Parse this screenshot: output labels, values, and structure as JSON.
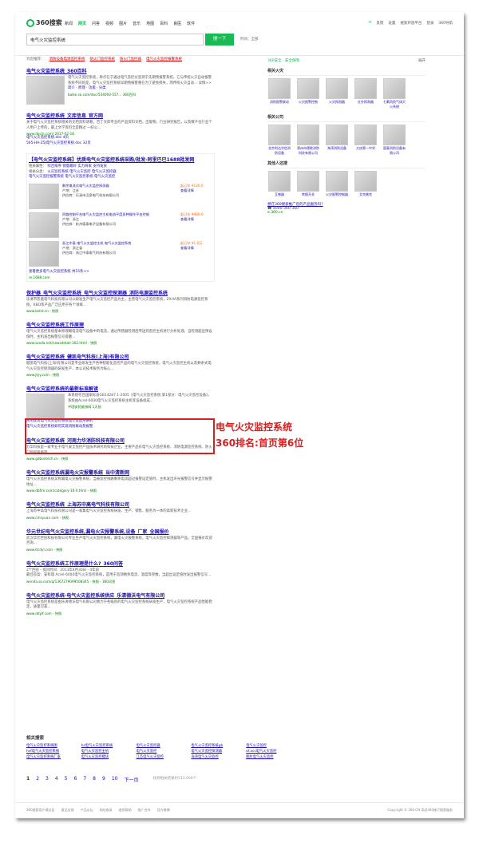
{
  "header": {
    "logo_text": "360搜索",
    "nav": [
      "新闻",
      "网页",
      "问答",
      "视频",
      "图片",
      "音乐",
      "地图",
      "百科",
      "良医",
      "软件"
    ],
    "nav_active_index": 1,
    "search_value": "电气火灾监控系统",
    "search_button": "搜一下",
    "time_filter": "时间：全部",
    "top_links": [
      "反馈",
      "设置",
      "搜索开放平台",
      "登录",
      "360导航"
    ],
    "accent_color": "#19b955"
  },
  "suggest": {
    "label": "为您推荐：",
    "items": [
      "消防设备电源监控系统",
      "防火门监控系统",
      "防火门监控器",
      "电气火灾监控报警系统"
    ]
  },
  "results": [
    {
      "title": "电气火灾监控系统_360百科",
      "desc": "电气火灾监控系统，将点在于通过电气监控仪监测于先期预报警系统，它与传统火灾自动报警系统不同的是，电气火灾监控系统早期预报警重在为了避免损失，而传统火灾自动... 详情>>",
      "sub": "简介 · 原理 · 功能 · 分类",
      "url": "baike.so.com/doc/534093-557...",
      "source_tag": "360百科"
    },
    {
      "title": "电气火灾监控系统_文库信息_官方网",
      "desc": "关于电气火灾监控系统相关的文档资料请看，百丁文库专业的产品资料文档，出版物，行业研究报告，以及数千位行业个人用户上传的，最上文学资料全是精过 一纪公...",
      "url": "www.docin.com/ 2017-02-18",
      "file1": "电气火灾监控系统.doc 4页",
      "file2": "565-HA-Z5J电气火灾监控系统.doc 32页"
    },
    {
      "title": "【电气火灾监控系统】优质电气火灾监控系统采购/批发-阿里巴巴1688批发网",
      "filters": [
        {
          "label": "相关属性：",
          "values": [
            "综合排序",
            "销量最好",
            "实力商家",
            "支持发货"
          ]
        },
        {
          "label": "相关分类：",
          "values": [
            "火灾监控系统",
            "电气火灾监控",
            "电气火灾监控器"
          ]
        },
        {
          "label": "",
          "values": [
            "电气火灾监控报警系统",
            "电气火灾监控系统",
            "电气火灾监控"
          ]
        }
      ],
      "products": [
        {
          "name": "剩余电流式电气火灾监控探测器",
          "price": "起订价 ¥120.0",
          "loc": "产地：江苏",
          "supplier": "供应商：乐清市汉泉电气科技有限公司",
          "action": "查看详情"
        },
        {
          "name": "四路控制平台电气火灾监控主机电流平度多种操作平台控制",
          "price": "起订价 ¥980.0",
          "loc": "产地：浙江",
          "supplier": "供应商：杭州德泰电子设备有限公司",
          "action": "查看详情"
        },
        {
          "name": "浙江中泰 电气火灾监控主机 电气火灾监控系统",
          "price": "起订价 ¥1.0万",
          "loc": "产地：浙江省",
          "supplier": "供应商：浙江中泰电气科技有限公司",
          "action": "查看详情"
        }
      ],
      "more": "查看更多电气火灾监控系统 共15条>>",
      "url": "re.1688.com"
    },
    {
      "title": "保护器_电气火灾监控系统_电气火灾监控探测器_消防电源监控系统",
      "desc": "乐清市凯能电气科技有限公司以研发生产电气火灾监控产品为主，主营电气火灾监控系统，ZXHA系列消防电源监控系统，KBO等产品广泛应用于各个领域...",
      "url": "www.kelet.cn - 快照"
    },
    {
      "title": "电气火灾监控系统工作原理",
      "desc": "电气火灾监控系统基本原理概电流电气设备中的电流，通过传感器检测后传送到监控主机进行分析处理，当检测超出预设值时，主机发出报警信号提醒...",
      "url": "www.szxda.net/newsdetail-302.html - 快照"
    },
    {
      "title": "电气火灾监控系统_健凯电气科技(上海)有限公司",
      "desc": "健凯电气科技(上海)有限公司是专业研发生产各种智能化监控产品的电气火灾监控系统，电气火灾监控主机以及剩余式电气火灾监控探测器的研发生产，本公司技术服务为核心...",
      "url": "www.jtyy.com - 快照",
      "annotated": true
    },
    {
      "title": "电气火灾监控系统的最新标准解读",
      "desc": "本系统符合国家标准GB14287.1-2005《电气火灾监控系统 第1部分：电气火灾监控设备》，系统由Acrel-6000电气火灾监控系统主机等设备组成...",
      "url": "中国安防维修网 1天前",
      "extra1": "民用建筑电气火灾监控系统设计及应用研究",
      "extra2": "电气火灾监控系统如何实现消防联动及报警"
    },
    {
      "title": "电气火灾监控系统_河南力华消防科技有限公司",
      "desc": "力华科技是一家专业于电气安全监控产品技术研究的科技企业，主要产品有电气火灾监控系统、消防电源监控系统、防火门监控系统等...",
      "url": "www.gdbontech.cn - 快照"
    },
    {
      "title": "电气火灾监控系统漏电火灾报警系统_当中清新网",
      "desc": "电气火灾监控系统又称漏电火灾报警系统，当被监控线路剩余电流超过报警设定值时，主机发出声光报警信号并显示报警地址...",
      "url": "www.dbfire.com/category-16-0.html - 快照"
    },
    {
      "title": "电气火灾监控系统_上海苏中高电气科技有限公司",
      "desc": "上海苏中高电气科技有限公司是一家集电气火灾监控系统研发、生产、销售、服务为一体的高新技术企业...",
      "url": "www.cmsyuan.com - 快照"
    },
    {
      "title": "华元世纪电气火灾监控系统,漏电火灾报警系统,设备_厂家_全国报价",
      "desc": "武汉华元世纪科技有限公司专业生产电气火灾监控系统，漏电火灾报警系统，电气火灾监控探测器等产品，全国报价欢迎咨询...",
      "url": "www.ltcdyl.com - 快照"
    },
    {
      "title": "电气火灾监控系统工作原理是什么?_360问答",
      "desc": "2个回答 - 提问时间：2013年4月30日 - 4年前",
      "desc2": "最佳答案：安科瑞 Acrel-6000电气火灾监控系统，是用于监测剩余电流、温度等参数，当超出设定值时发出报警信号...",
      "url": "wenda.so.com/q/1367279099508345 - 快照 - 360问答"
    },
    {
      "title": "电气火灾监控系统·电气火灾监控系统供应_乐清德沃电气有限公司",
      "desc": "电气火灾监控系统是由乐清德沃电气有限公司致力于各级别的电气火灾监控系统研发生产，电气火灾监控系统产品性能稳定，质量可靠...",
      "url": "www.ddylf.com - 快照"
    }
  ],
  "annotation": {
    "line1": "电气火灾监控系统",
    "line2": "360排名:首页第6位",
    "color": "#d42020"
  },
  "related_searches": {
    "title": "相关搜索",
    "items": [
      "电气火灾监控系统图",
      "hs电气火灾监控系统",
      "电气火灾监控器",
      "电气火灾监控系统gb",
      "电气火灾监控",
      "hvf电气火灾监控系统",
      "电气火灾监控主机",
      "电气火灾监控",
      "电气火灾监控探测器",
      "ef.acs电气火灾监控",
      "电气火灾监控系统厂家",
      "电气火灾监控模块",
      "江苏电气火灾监控",
      "海湾电气火灾监控",
      "图片电气火灾监控"
    ]
  },
  "pagination": {
    "pages": [
      "1",
      "2",
      "3",
      "4",
      "5",
      "6",
      "7",
      "8",
      "9",
      "10"
    ],
    "current": "1",
    "next": "下一页",
    "count": "找到相关结果约513,000个"
  },
  "sidebar": {
    "safe": "360安全 · 安全保障",
    "more": "展开",
    "section1": {
      "title": "相关火灾",
      "items": [
        "消防报警联动",
        "火灾报警控制",
        "火灾探测器",
        "红外探测器",
        "七氟丙烷气体灭火系统"
      ]
    },
    "section2": {
      "title": "相关公司",
      "items": [
        "北京利达华信消防设备",
        "郑州市德欧消防科技有限公司",
        "海湾消防设备",
        "大庆第一中学",
        "国泰消防设备有限公司"
      ]
    },
    "section3": {
      "title": "其他人还搜",
      "items": [
        "互感器",
        "转换开关",
        "火灾报警控制器",
        "艾克普克"
      ]
    },
    "ad_title": "想在360搜索推广您的产品服务吗?",
    "ad_phone": "4000-360-360",
    "ad_url": "e.360.cn"
  },
  "footer": {
    "links": [
      "360搜索用户建议区",
      "意见反馈",
      "产品论坛",
      "网站收录",
      "使用帮助",
      "推广合作",
      "官方微博"
    ],
    "copyright": "Copyright © 360.CN 奇虎360旗下搜索服务"
  }
}
